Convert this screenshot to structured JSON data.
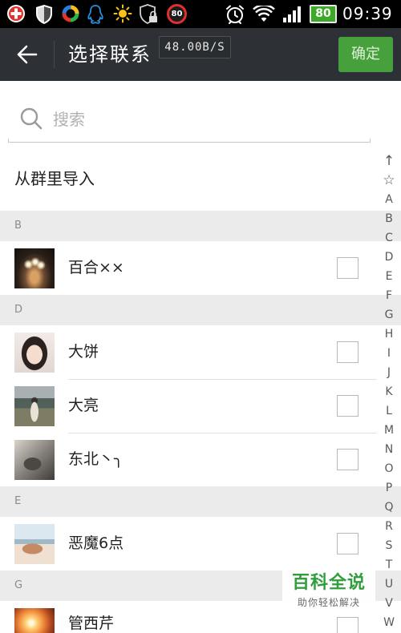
{
  "colors": {
    "status_bar_bg": "#000000",
    "header_bg": "#2d3135",
    "confirm_bg": "#46a03b",
    "section_bg": "#ebebeb",
    "watermark_green": "#2f9e3b"
  },
  "status_bar": {
    "left_icons": [
      "add-circle-icon",
      "shield-icon",
      "security-360-icon",
      "qq-icon",
      "weather-sun-icon",
      "lock-shield-icon"
    ],
    "notification_badge": "80",
    "right_icons": [
      "alarm-icon",
      "wifi-icon",
      "signal-icon",
      "battery-icon"
    ],
    "battery_level": "80",
    "time": "09:39"
  },
  "header": {
    "back_icon": "arrow-left-icon",
    "title": "选择联系",
    "confirm_label": "确定"
  },
  "speed_overlay": "48.00B/S",
  "search": {
    "icon": "search-icon",
    "placeholder": "搜索"
  },
  "import_from_group": "从群里导入",
  "sections": [
    {
      "letter": "B",
      "contacts": [
        {
          "name": "百合××",
          "checked": false
        }
      ]
    },
    {
      "letter": "D",
      "contacts": [
        {
          "name": "大饼",
          "checked": false
        },
        {
          "name": "大亮",
          "checked": false
        },
        {
          "name": "东北丶╮",
          "checked": false
        }
      ]
    },
    {
      "letter": "E",
      "contacts": [
        {
          "name": "恶魔6点",
          "checked": false
        }
      ]
    },
    {
      "letter": "G",
      "contacts": [
        {
          "name": "管西芹",
          "checked": false
        }
      ]
    }
  ],
  "index_bar": [
    "↑",
    "☆",
    "A",
    "B",
    "C",
    "D",
    "E",
    "F",
    "G",
    "H",
    "I",
    "J",
    "K",
    "L",
    "M",
    "N",
    "O",
    "P",
    "Q",
    "R",
    "S",
    "T",
    "U",
    "V",
    "W"
  ],
  "watermark": {
    "title": "百科全说",
    "subtitle": "助你轻松解决"
  }
}
